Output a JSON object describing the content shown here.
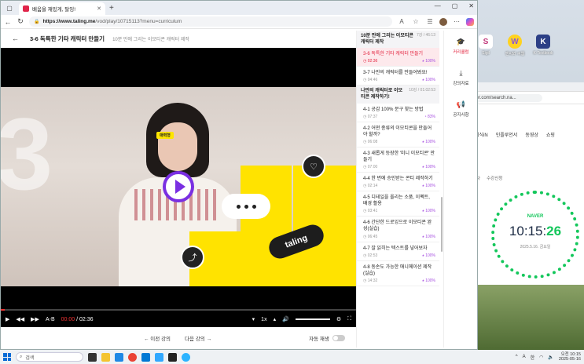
{
  "desktop": {
    "icons": [
      {
        "label": "Sigil",
        "glyph": "S",
        "color": "#c0367a"
      },
      {
        "label": "엔씨와 씨웹",
        "glyph": "W",
        "color": "#8a56d8"
      },
      {
        "label": "K-Textbook",
        "glyph": "K",
        "color": "#2c3f86"
      }
    ]
  },
  "naver_window": {
    "url": "naver.com/search.na...",
    "nav_tabs": [
      "지식iN",
      "인플루언서",
      "동영상",
      "쇼핑"
    ],
    "sub_tabs": [
      "기차",
      "수강신청"
    ],
    "clock": {
      "brand": "NAVER",
      "hm": "10:15:",
      "sec": "26",
      "date": "2025.5.16. 금요일"
    }
  },
  "browser": {
    "tab_title": "배움을 재밌게, 탈잉!",
    "url_host": "https://www.taling.me",
    "url_path": "/vod/play/10715113?menu=curriculum"
  },
  "header": {
    "title": "3-6 독특한 기타 캐릭터 만들기",
    "subtitle": "10분 만에 그리는 이모티콘 캐릭터 제작"
  },
  "video": {
    "big_number": "3",
    "tag": "매력형",
    "brand": "taling",
    "current_time": "00:00",
    "duration": "02:36",
    "speed": "1x",
    "ab": "A-B"
  },
  "below_nav": {
    "prev": "← 이전 강의",
    "next": "다음 강의 →",
    "autoplay": "자동 재생"
  },
  "curriculum": {
    "sections": [
      {
        "title": "10분 만에 그리는 이모티콘 캐릭터 제작",
        "meta": "7강 / 46:13",
        "lessons": [
          {
            "title": "3-6 독특한 기타 캐릭터 만들기",
            "duration": "02:36",
            "progress": "100%",
            "active": true
          },
          {
            "title": "3-7 나만의 캐릭터를 만들어봐요!",
            "duration": "04:46",
            "progress": "100%",
            "active": false
          }
        ]
      },
      {
        "title": "나만의 캐릭터로 이모티콘 제작하기!",
        "meta": "10강 / 01:02:53",
        "lessons": [
          {
            "title": "4-1 공감 100% 문구 찾는 방법",
            "duration": "07:37",
            "progress": "83%",
            "active": false
          },
          {
            "title": "4-2 어떤 종류의 이모티콘을 만들어야 할까?",
            "duration": "06:08",
            "progress": "100%",
            "active": false
          },
          {
            "title": "4-3 새롭게 등장한 '미니 이모티콘' 만들기",
            "duration": "07:00",
            "progress": "100%",
            "active": false
          },
          {
            "title": "4-4 한 번에 승인받는 콘티 제작하기",
            "duration": "02:14",
            "progress": "100%",
            "active": false
          },
          {
            "title": "4-5 디테일을 올리는 소품, 이펙트, 배경 활용",
            "duration": "03:41",
            "progress": "100%",
            "active": false
          },
          {
            "title": "4-6 간단한 드로잉으로 이모티콘 완성(실습)",
            "duration": "06:45",
            "progress": "100%",
            "active": false
          },
          {
            "title": "4-7 잘 읽히는 텍스트를 넣어보자",
            "duration": "02:53",
            "progress": "100%",
            "active": false
          },
          {
            "title": "4-8 동손도 가능한 애니메이션 제작(실습)",
            "duration": "14:32",
            "progress": "100%",
            "active": false
          }
        ]
      }
    ]
  },
  "rail": {
    "items": [
      {
        "label": "커리큘럼",
        "icon": "graduation-cap-icon",
        "glyph": "🎓"
      },
      {
        "label": "강의자료",
        "icon": "download-icon",
        "glyph": "⤓"
      },
      {
        "label": "공지사항",
        "icon": "megaphone-icon",
        "glyph": "📢"
      }
    ]
  },
  "taskbar": {
    "search_placeholder": "검색",
    "time": "오전 10:15",
    "date": "2025-05-16",
    "ime": "A",
    "lang": "한"
  },
  "colors": {
    "accent": "#e3243f",
    "player_purple": "#7a2fe2",
    "yellow": "#ffe300",
    "naver_green": "#13c75b",
    "progress_purple": "#a64fe0"
  }
}
